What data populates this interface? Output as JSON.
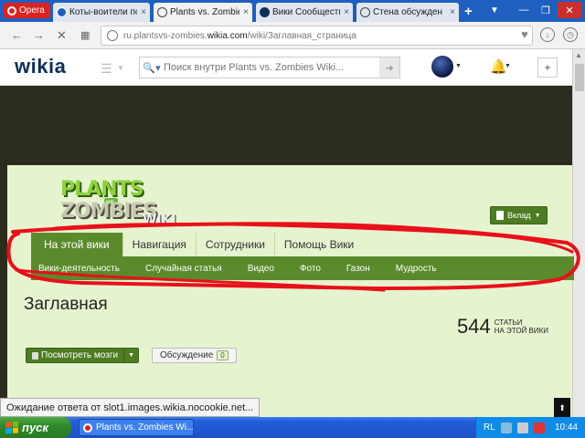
{
  "browser": {
    "opera_label": "Opera",
    "tabs": [
      {
        "label": "Коты-воители по",
        "close": "×"
      },
      {
        "label": "Plants vs. Zombies",
        "close": "×"
      },
      {
        "label": "Вики Сообщество",
        "close": "×"
      },
      {
        "label": "Стена обсужден",
        "close": "×"
      }
    ],
    "new_tab": "+",
    "url_prefix": "ru.plantsvs-zombies.",
    "url_domain": "wikia.com",
    "url_path": "/wiki/Заглавная_страница"
  },
  "wikia": {
    "logo": "wikia",
    "search_placeholder": "Поиск внутри Plants vs. Zombies Wiki...",
    "plus": "+"
  },
  "wiki": {
    "logo_plants": "PLANTS",
    "logo_vs": "vs.",
    "logo_zombies": "ZOMBIES",
    "logo_wiki": "WIKI",
    "contribute": "Вклад",
    "tabs": [
      "На этой вики",
      "Навигация",
      "Сотрудники",
      "Помощь Вики"
    ],
    "subnav": [
      "Вики-деятельность",
      "Случайная статья",
      "Видео",
      "Фото",
      "Газон",
      "Мудрость"
    ],
    "page_title": "Заглавная",
    "article_count": "544",
    "count_label_1": "статьи",
    "count_label_2": "на этой вики",
    "edit_label": "Посмотреть мозги",
    "talk_label": "Обсуждение",
    "talk_count": "0"
  },
  "status_text": "Ожидание ответа от slot1.images.wikia.nocookie.net...",
  "taskbar": {
    "start": "пуск",
    "task": "Plants vs. Zombies Wi...",
    "lang": "RL",
    "clock": "10:44"
  },
  "colors": {
    "wiki_bg": "#e6f3cf",
    "accent_green": "#5a8a2b",
    "scribble_red": "#e8101a"
  }
}
